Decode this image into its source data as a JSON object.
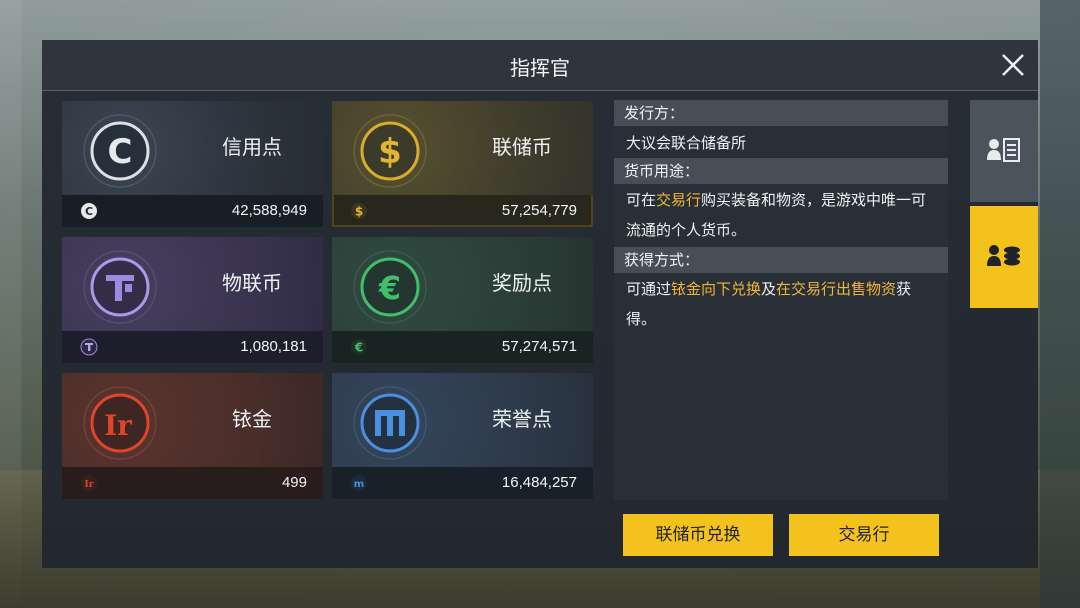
{
  "window": {
    "title": "指挥官"
  },
  "colors": {
    "accent": "#f4c21d",
    "highlight_text": "#f3b63a",
    "selected_outline": "#f1c22c"
  },
  "currencies": [
    {
      "name": "信用点",
      "amount": "42,588,949",
      "icon": "credit-c-icon",
      "color": "#e6e9ec"
    },
    {
      "name": "联储币",
      "amount": "57,254,779",
      "icon": "dollar-icon",
      "color": "#e2b632",
      "selected": true
    },
    {
      "name": "物联币",
      "amount": "1,080,181",
      "icon": "iot-t-icon",
      "color": "#9a8be0"
    },
    {
      "name": "奖励点",
      "amount": "57,274,571",
      "icon": "reward-e-icon",
      "color": "#3fbf6a"
    },
    {
      "name": "铱金",
      "amount": "499",
      "icon": "iridium-ir-icon",
      "color": "#e0452a"
    },
    {
      "name": "荣誉点",
      "amount": "16,484,257",
      "icon": "honor-m-icon",
      "color": "#4a8fe0"
    }
  ],
  "info": {
    "issuer_label": "发行方：",
    "issuer_value": "大议会联合储备所",
    "usage_label": "货币用途：",
    "usage_part1": "可在",
    "usage_link1": "交易行",
    "usage_part2": "购买装备和物资，是游戏中唯一可流通的个人货币。",
    "obtain_label": "获得方式：",
    "obtain_part1": "可通过",
    "obtain_link1": "铱金向下兑换",
    "obtain_part2": "及",
    "obtain_link2": "在交易行出售物资",
    "obtain_part3": "获得。"
  },
  "tabs": [
    {
      "icon": "profile-list-icon",
      "active": false
    },
    {
      "icon": "currency-stack-icon",
      "active": true
    }
  ],
  "buttons": {
    "exchange": "联储币兑换",
    "market": "交易行"
  }
}
